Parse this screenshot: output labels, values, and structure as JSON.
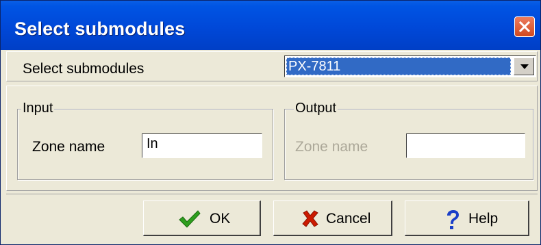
{
  "window": {
    "title": "Select submodules",
    "close_icon": "close-icon"
  },
  "selector": {
    "label": "Select submodules",
    "value": "PX-7811",
    "dropdown_icon": "chevron-down-icon"
  },
  "input_group": {
    "title": "Input",
    "zone_label": "Zone name",
    "zone_value": "In",
    "enabled": true
  },
  "output_group": {
    "title": "Output",
    "zone_label": "Zone name",
    "zone_value": "",
    "enabled": false
  },
  "buttons": {
    "ok": {
      "label": "OK",
      "icon": "checkmark-icon",
      "icon_color": "#2e9e1e"
    },
    "cancel": {
      "label": "Cancel",
      "icon": "x-mark-icon",
      "icon_color": "#cc1a00"
    },
    "help": {
      "label": "Help",
      "icon": "question-mark-icon",
      "icon_color": "#1a3fc8"
    }
  },
  "colors": {
    "title_bar": "#0054e3",
    "selection": "#316ac5",
    "face": "#ece9d8",
    "close_button": "#d24a1f"
  }
}
